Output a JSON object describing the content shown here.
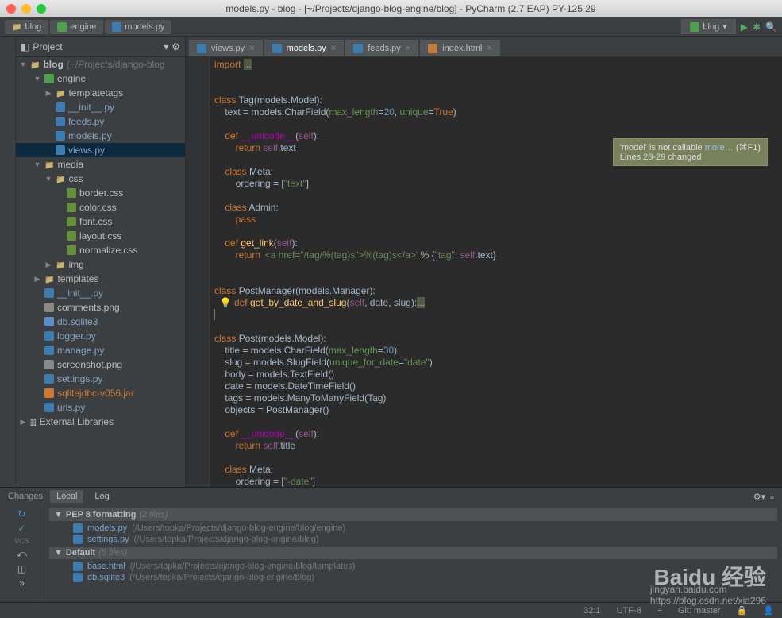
{
  "window": {
    "title": "models.py - blog - [~/Projects/django-blog-engine/blog] - PyCharm (2.7 EAP) PY-125.29"
  },
  "breadcrumb": [
    "blog",
    "engine",
    "models.py"
  ],
  "run_config": "blog",
  "sidebar": {
    "header": "Project",
    "root": {
      "name": "blog",
      "hint": "(~/Projects/django-blog"
    },
    "items": [
      {
        "indent": 1,
        "arrow": "▼",
        "icon": "dj",
        "label": "engine"
      },
      {
        "indent": 2,
        "arrow": "▶",
        "icon": "folder",
        "label": "templatetags"
      },
      {
        "indent": 2,
        "arrow": "",
        "icon": "py",
        "label": "__init__.py",
        "cls": "py"
      },
      {
        "indent": 2,
        "arrow": "",
        "icon": "py",
        "label": "feeds.py",
        "cls": "py"
      },
      {
        "indent": 2,
        "arrow": "",
        "icon": "py",
        "label": "models.py",
        "cls": "py"
      },
      {
        "indent": 2,
        "arrow": "",
        "icon": "py",
        "label": "views.py",
        "cls": "py",
        "selected": true
      },
      {
        "indent": 1,
        "arrow": "▼",
        "icon": "folder",
        "label": "media"
      },
      {
        "indent": 2,
        "arrow": "▼",
        "icon": "folder",
        "label": "css"
      },
      {
        "indent": 3,
        "arrow": "",
        "icon": "css",
        "label": "border.css"
      },
      {
        "indent": 3,
        "arrow": "",
        "icon": "css",
        "label": "color.css"
      },
      {
        "indent": 3,
        "arrow": "",
        "icon": "css",
        "label": "font.css"
      },
      {
        "indent": 3,
        "arrow": "",
        "icon": "css",
        "label": "layout.css"
      },
      {
        "indent": 3,
        "arrow": "",
        "icon": "css",
        "label": "normalize.css"
      },
      {
        "indent": 2,
        "arrow": "▶",
        "icon": "folder",
        "label": "img"
      },
      {
        "indent": 1,
        "arrow": "▶",
        "icon": "folder",
        "label": "templates"
      },
      {
        "indent": 1,
        "arrow": "",
        "icon": "py",
        "label": "__init__.py",
        "cls": "py"
      },
      {
        "indent": 1,
        "arrow": "",
        "icon": "png",
        "label": "comments.png"
      },
      {
        "indent": 1,
        "arrow": "",
        "icon": "db",
        "label": "db.sqlite3",
        "cls": "py"
      },
      {
        "indent": 1,
        "arrow": "",
        "icon": "py",
        "label": "logger.py",
        "cls": "py"
      },
      {
        "indent": 1,
        "arrow": "",
        "icon": "py",
        "label": "manage.py",
        "cls": "py"
      },
      {
        "indent": 1,
        "arrow": "",
        "icon": "png",
        "label": "screenshot.png"
      },
      {
        "indent": 1,
        "arrow": "",
        "icon": "py",
        "label": "settings.py",
        "cls": "py"
      },
      {
        "indent": 1,
        "arrow": "",
        "icon": "jar",
        "label": "sqlitejdbc-v056.jar",
        "cls": "orange"
      },
      {
        "indent": 1,
        "arrow": "",
        "icon": "py",
        "label": "urls.py",
        "cls": "py"
      }
    ],
    "external": "External Libraries"
  },
  "tabs": [
    {
      "icon": "py",
      "label": "views.py"
    },
    {
      "icon": "py",
      "label": "models.py",
      "active": true
    },
    {
      "icon": "py",
      "label": "feeds.py"
    },
    {
      "icon": "html",
      "label": "index.html"
    }
  ],
  "tooltip": {
    "line1": "'model' is not callable",
    "more": "more…",
    "shortcut": "(⌘F1)",
    "line2": "Lines 28-29 changed"
  },
  "changes": {
    "label": "Changes:",
    "tabs": [
      "Local",
      "Log"
    ],
    "groups": [
      {
        "name": "PEP 8 formatting",
        "count": "(2 files)",
        "items": [
          {
            "name": "models.py",
            "path": "(/Users/topka/Projects/django-blog-engine/blog/engine)"
          },
          {
            "name": "settings.py",
            "path": "(/Users/topka/Projects/django-blog-engine/blog)"
          }
        ]
      },
      {
        "name": "Default",
        "count": "(5 files)",
        "items": [
          {
            "name": "base.html",
            "path": "(/Users/topka/Projects/django-blog-engine/blog/templates)"
          },
          {
            "name": "db.sqlite3",
            "path": "(/Users/topka/Projects/django-blog-engine/blog)"
          }
        ]
      }
    ]
  },
  "status": {
    "pos": "32:1",
    "encoding": "UTF-8",
    "git": "Git: master"
  },
  "watermark": {
    "main": "Baidu 经验",
    "sub": "jingyan.baidu.com",
    "csdn": "https://blog.csdn.net/xia296"
  }
}
